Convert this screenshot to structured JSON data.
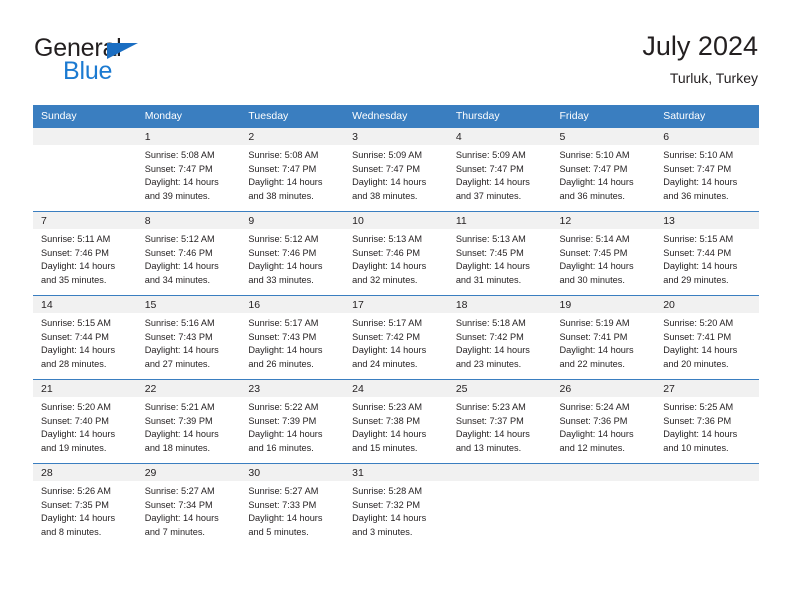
{
  "brand": {
    "name_part1": "General",
    "name_part2": "Blue",
    "accent_color": "#1b7ad1",
    "triangle_color": "#1b6ec2"
  },
  "header": {
    "title": "July 2024",
    "subtitle": "Turluk, Turkey"
  },
  "calendar": {
    "header_bg": "#3a7ec0",
    "daynum_band_bg": "#f1f1f1",
    "weekday_headers": [
      "Sunday",
      "Monday",
      "Tuesday",
      "Wednesday",
      "Thursday",
      "Friday",
      "Saturday"
    ],
    "weeks": [
      [
        {
          "day": "",
          "sunrise": "",
          "sunset": "",
          "daylight_line1": "",
          "daylight_line2": ""
        },
        {
          "day": "1",
          "sunrise": "Sunrise: 5:08 AM",
          "sunset": "Sunset: 7:47 PM",
          "daylight_line1": "Daylight: 14 hours",
          "daylight_line2": "and 39 minutes."
        },
        {
          "day": "2",
          "sunrise": "Sunrise: 5:08 AM",
          "sunset": "Sunset: 7:47 PM",
          "daylight_line1": "Daylight: 14 hours",
          "daylight_line2": "and 38 minutes."
        },
        {
          "day": "3",
          "sunrise": "Sunrise: 5:09 AM",
          "sunset": "Sunset: 7:47 PM",
          "daylight_line1": "Daylight: 14 hours",
          "daylight_line2": "and 38 minutes."
        },
        {
          "day": "4",
          "sunrise": "Sunrise: 5:09 AM",
          "sunset": "Sunset: 7:47 PM",
          "daylight_line1": "Daylight: 14 hours",
          "daylight_line2": "and 37 minutes."
        },
        {
          "day": "5",
          "sunrise": "Sunrise: 5:10 AM",
          "sunset": "Sunset: 7:47 PM",
          "daylight_line1": "Daylight: 14 hours",
          "daylight_line2": "and 36 minutes."
        },
        {
          "day": "6",
          "sunrise": "Sunrise: 5:10 AM",
          "sunset": "Sunset: 7:47 PM",
          "daylight_line1": "Daylight: 14 hours",
          "daylight_line2": "and 36 minutes."
        }
      ],
      [
        {
          "day": "7",
          "sunrise": "Sunrise: 5:11 AM",
          "sunset": "Sunset: 7:46 PM",
          "daylight_line1": "Daylight: 14 hours",
          "daylight_line2": "and 35 minutes."
        },
        {
          "day": "8",
          "sunrise": "Sunrise: 5:12 AM",
          "sunset": "Sunset: 7:46 PM",
          "daylight_line1": "Daylight: 14 hours",
          "daylight_line2": "and 34 minutes."
        },
        {
          "day": "9",
          "sunrise": "Sunrise: 5:12 AM",
          "sunset": "Sunset: 7:46 PM",
          "daylight_line1": "Daylight: 14 hours",
          "daylight_line2": "and 33 minutes."
        },
        {
          "day": "10",
          "sunrise": "Sunrise: 5:13 AM",
          "sunset": "Sunset: 7:46 PM",
          "daylight_line1": "Daylight: 14 hours",
          "daylight_line2": "and 32 minutes."
        },
        {
          "day": "11",
          "sunrise": "Sunrise: 5:13 AM",
          "sunset": "Sunset: 7:45 PM",
          "daylight_line1": "Daylight: 14 hours",
          "daylight_line2": "and 31 minutes."
        },
        {
          "day": "12",
          "sunrise": "Sunrise: 5:14 AM",
          "sunset": "Sunset: 7:45 PM",
          "daylight_line1": "Daylight: 14 hours",
          "daylight_line2": "and 30 minutes."
        },
        {
          "day": "13",
          "sunrise": "Sunrise: 5:15 AM",
          "sunset": "Sunset: 7:44 PM",
          "daylight_line1": "Daylight: 14 hours",
          "daylight_line2": "and 29 minutes."
        }
      ],
      [
        {
          "day": "14",
          "sunrise": "Sunrise: 5:15 AM",
          "sunset": "Sunset: 7:44 PM",
          "daylight_line1": "Daylight: 14 hours",
          "daylight_line2": "and 28 minutes."
        },
        {
          "day": "15",
          "sunrise": "Sunrise: 5:16 AM",
          "sunset": "Sunset: 7:43 PM",
          "daylight_line1": "Daylight: 14 hours",
          "daylight_line2": "and 27 minutes."
        },
        {
          "day": "16",
          "sunrise": "Sunrise: 5:17 AM",
          "sunset": "Sunset: 7:43 PM",
          "daylight_line1": "Daylight: 14 hours",
          "daylight_line2": "and 26 minutes."
        },
        {
          "day": "17",
          "sunrise": "Sunrise: 5:17 AM",
          "sunset": "Sunset: 7:42 PM",
          "daylight_line1": "Daylight: 14 hours",
          "daylight_line2": "and 24 minutes."
        },
        {
          "day": "18",
          "sunrise": "Sunrise: 5:18 AM",
          "sunset": "Sunset: 7:42 PM",
          "daylight_line1": "Daylight: 14 hours",
          "daylight_line2": "and 23 minutes."
        },
        {
          "day": "19",
          "sunrise": "Sunrise: 5:19 AM",
          "sunset": "Sunset: 7:41 PM",
          "daylight_line1": "Daylight: 14 hours",
          "daylight_line2": "and 22 minutes."
        },
        {
          "day": "20",
          "sunrise": "Sunrise: 5:20 AM",
          "sunset": "Sunset: 7:41 PM",
          "daylight_line1": "Daylight: 14 hours",
          "daylight_line2": "and 20 minutes."
        }
      ],
      [
        {
          "day": "21",
          "sunrise": "Sunrise: 5:20 AM",
          "sunset": "Sunset: 7:40 PM",
          "daylight_line1": "Daylight: 14 hours",
          "daylight_line2": "and 19 minutes."
        },
        {
          "day": "22",
          "sunrise": "Sunrise: 5:21 AM",
          "sunset": "Sunset: 7:39 PM",
          "daylight_line1": "Daylight: 14 hours",
          "daylight_line2": "and 18 minutes."
        },
        {
          "day": "23",
          "sunrise": "Sunrise: 5:22 AM",
          "sunset": "Sunset: 7:39 PM",
          "daylight_line1": "Daylight: 14 hours",
          "daylight_line2": "and 16 minutes."
        },
        {
          "day": "24",
          "sunrise": "Sunrise: 5:23 AM",
          "sunset": "Sunset: 7:38 PM",
          "daylight_line1": "Daylight: 14 hours",
          "daylight_line2": "and 15 minutes."
        },
        {
          "day": "25",
          "sunrise": "Sunrise: 5:23 AM",
          "sunset": "Sunset: 7:37 PM",
          "daylight_line1": "Daylight: 14 hours",
          "daylight_line2": "and 13 minutes."
        },
        {
          "day": "26",
          "sunrise": "Sunrise: 5:24 AM",
          "sunset": "Sunset: 7:36 PM",
          "daylight_line1": "Daylight: 14 hours",
          "daylight_line2": "and 12 minutes."
        },
        {
          "day": "27",
          "sunrise": "Sunrise: 5:25 AM",
          "sunset": "Sunset: 7:36 PM",
          "daylight_line1": "Daylight: 14 hours",
          "daylight_line2": "and 10 minutes."
        }
      ],
      [
        {
          "day": "28",
          "sunrise": "Sunrise: 5:26 AM",
          "sunset": "Sunset: 7:35 PM",
          "daylight_line1": "Daylight: 14 hours",
          "daylight_line2": "and 8 minutes."
        },
        {
          "day": "29",
          "sunrise": "Sunrise: 5:27 AM",
          "sunset": "Sunset: 7:34 PM",
          "daylight_line1": "Daylight: 14 hours",
          "daylight_line2": "and 7 minutes."
        },
        {
          "day": "30",
          "sunrise": "Sunrise: 5:27 AM",
          "sunset": "Sunset: 7:33 PM",
          "daylight_line1": "Daylight: 14 hours",
          "daylight_line2": "and 5 minutes."
        },
        {
          "day": "31",
          "sunrise": "Sunrise: 5:28 AM",
          "sunset": "Sunset: 7:32 PM",
          "daylight_line1": "Daylight: 14 hours",
          "daylight_line2": "and 3 minutes."
        },
        {
          "day": "",
          "sunrise": "",
          "sunset": "",
          "daylight_line1": "",
          "daylight_line2": ""
        },
        {
          "day": "",
          "sunrise": "",
          "sunset": "",
          "daylight_line1": "",
          "daylight_line2": ""
        },
        {
          "day": "",
          "sunrise": "",
          "sunset": "",
          "daylight_line1": "",
          "daylight_line2": ""
        }
      ]
    ]
  }
}
